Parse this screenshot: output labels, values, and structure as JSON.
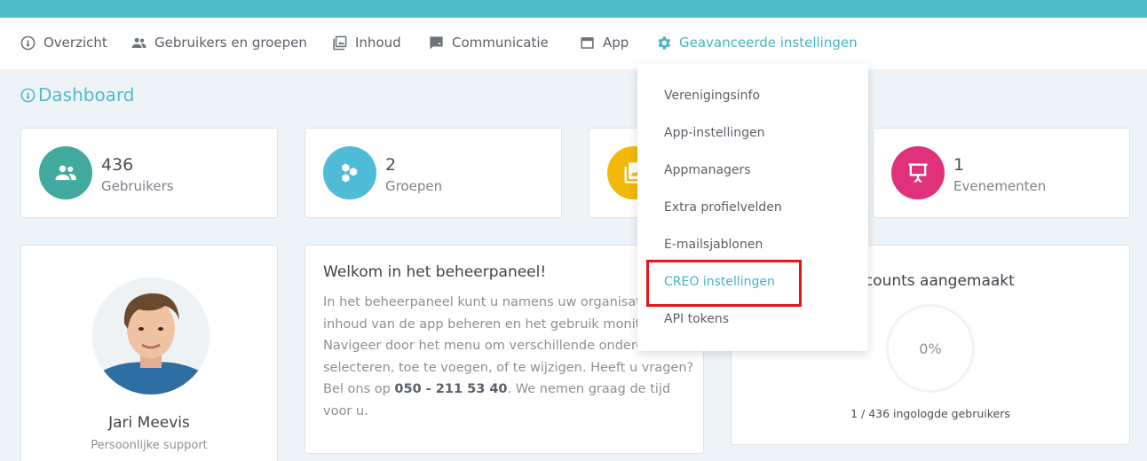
{
  "nav": {
    "items": [
      {
        "label": "Overzicht",
        "icon": "dashboard-icon"
      },
      {
        "label": "Gebruikers en groepen",
        "icon": "users-icon"
      },
      {
        "label": "Inhoud",
        "icon": "content-icon"
      },
      {
        "label": "Communicatie",
        "icon": "message-icon"
      },
      {
        "label": "App",
        "icon": "app-window-icon"
      },
      {
        "label": "Geavanceerde instellingen",
        "icon": "gear-icon",
        "active": true
      }
    ]
  },
  "page": {
    "title": "Dashboard"
  },
  "stats": [
    {
      "value": "436",
      "label": "Gebruikers",
      "color": "#41aa9f",
      "icon": "users-icon"
    },
    {
      "value": "2",
      "label": "Groepen",
      "color": "#4fbcd7",
      "icon": "hexagons-icon"
    },
    {
      "value": "",
      "label": "",
      "color": "#f2b807",
      "icon": "images-icon"
    },
    {
      "value": "1",
      "label": "Evenementen",
      "color": "#e0327a",
      "icon": "presentation-icon"
    }
  ],
  "profile": {
    "name": "Jari Meevis",
    "role": "Persoonlijke support"
  },
  "welcome": {
    "title": "Welkom in het beheerpaneel!",
    "text": "In het beheerpaneel kunt u namens uw organisatie de inhoud van de app beheren en het gebruik monitoren. Navigeer door het menu om verschillende onderdelen te selecteren, toe te voegen, of te wijzigen. Heeft u vragen? Bel ons op",
    "phone": "050 - 211 53 40",
    "text_end": ". We nemen graag de tijd voor u."
  },
  "accounts": {
    "title": "Accounts aangemaakt",
    "percent": "0%",
    "subtitle": "1 / 436 ingologde gebruikers"
  },
  "dropdown": {
    "items": [
      {
        "label": "Verenigingsinfo"
      },
      {
        "label": "App-instellingen"
      },
      {
        "label": "Appmanagers"
      },
      {
        "label": "Extra profielvelden"
      },
      {
        "label": "E-mailsjablonen"
      },
      {
        "label": "CREO instellingen",
        "active": true
      },
      {
        "label": "API tokens"
      }
    ],
    "highlight_color": "#e8141c"
  }
}
